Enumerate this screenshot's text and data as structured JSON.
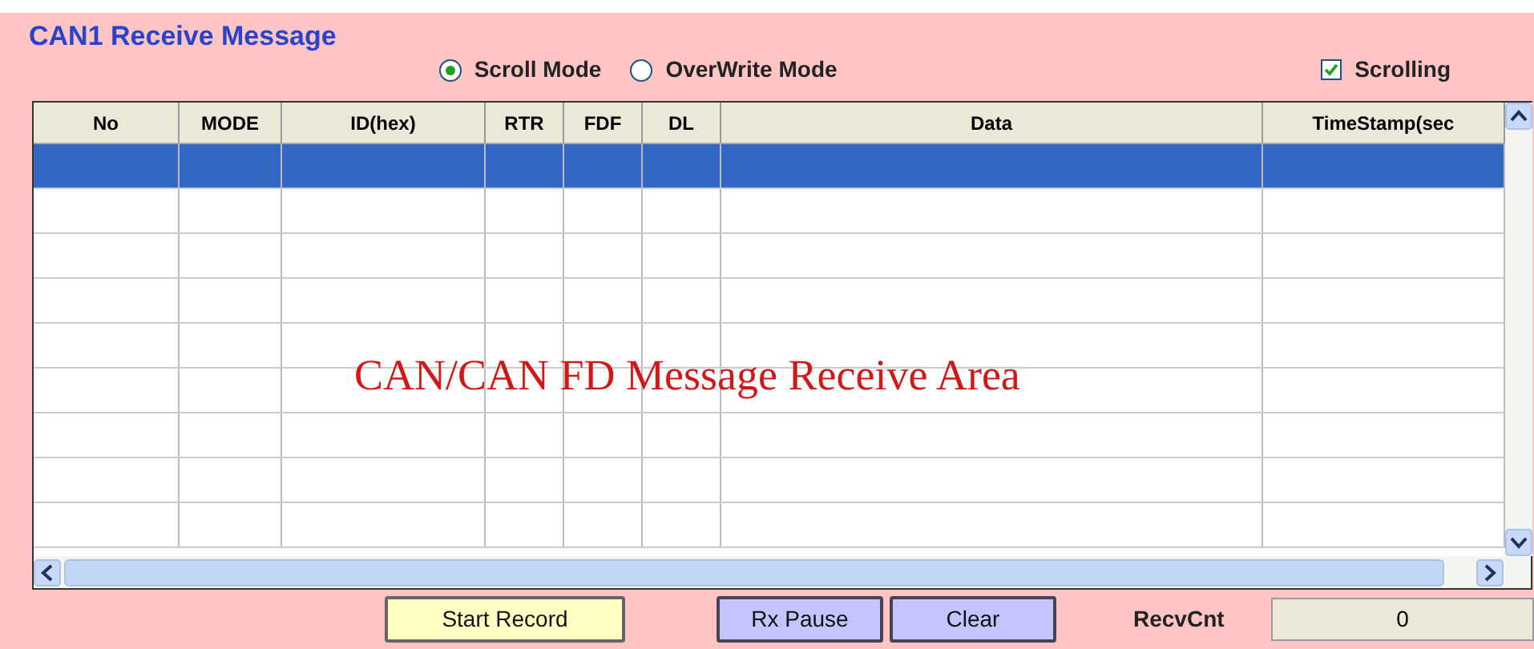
{
  "group": {
    "title": "CAN1 Receive Message"
  },
  "modes": [
    {
      "label": "Scroll Mode",
      "selected": true
    },
    {
      "label": "OverWrite Mode",
      "selected": false
    }
  ],
  "scrolling": {
    "label": "Scrolling",
    "checked": true
  },
  "table": {
    "columns": [
      "No",
      "MODE",
      "ID(hex)",
      "RTR",
      "FDF",
      "DL",
      "Data",
      "TimeStamp(sec"
    ],
    "rows": [
      {
        "selected": true
      },
      {
        "selected": false
      },
      {
        "selected": false
      },
      {
        "selected": false
      },
      {
        "selected": false
      },
      {
        "selected": false
      },
      {
        "selected": false
      },
      {
        "selected": false
      },
      {
        "selected": false
      }
    ],
    "overlay": "CAN/CAN FD Message Receive Area"
  },
  "buttons": [
    {
      "label": "Start Record",
      "kind": "record"
    },
    {
      "label": "Rx Pause",
      "kind": "action"
    },
    {
      "label": "Clear",
      "kind": "action"
    }
  ],
  "recv_cnt": {
    "label": "RecvCnt",
    "value": "0"
  }
}
